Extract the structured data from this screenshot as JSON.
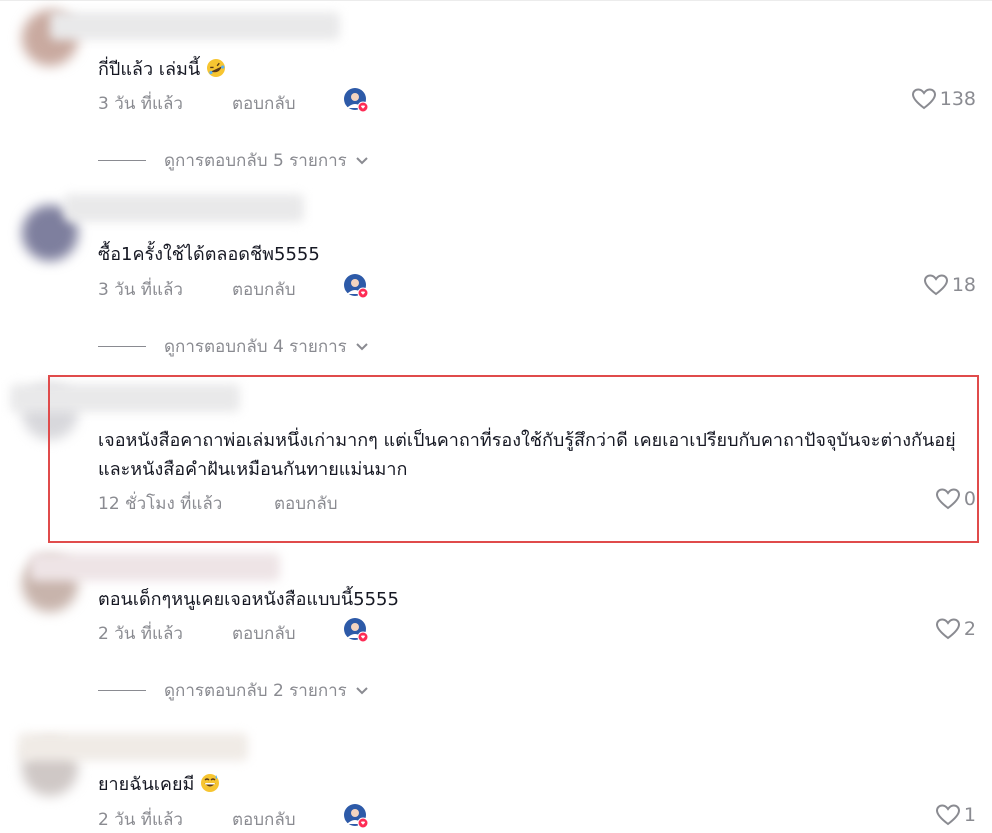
{
  "colors": {
    "highlight": "#e04b4b",
    "muted": "#8a8b91",
    "text": "#161823",
    "heart_badge": "#fe2c55"
  },
  "comments": [
    {
      "text": "กี่ปีแล้ว เล่มนี้",
      "emoji": "rolling-on-floor-laughing-emoji",
      "time": "3 วัน ที่แล้ว",
      "reply_label": "ตอบกลับ",
      "author_liked": true,
      "likes": "138",
      "view_replies": "ดูการตอบกลับ 5 รายการ"
    },
    {
      "text": "ซื้อ1ครั้งใช้ได้ตลอดชีพ5555",
      "time": "3 วัน ที่แล้ว",
      "reply_label": "ตอบกลับ",
      "author_liked": true,
      "likes": "18",
      "view_replies": "ดูการตอบกลับ 4 รายการ"
    },
    {
      "text": "เจอหนังสือคาถาพ่อเล่มหนึ่งเก่ามากๆ แต่เป็นคาถาที่รองใช้กับรู้สึกว่าดี เคยเอาเปรียบกับคาถาปัจจุบันจะต่างกันอยุ่ และหนังสือคำฝันเหมือนกันทายแม่นมาก",
      "time": "12 ชั่วโมง ที่แล้ว",
      "reply_label": "ตอบกลับ",
      "author_liked": false,
      "likes": "0",
      "highlighted": true
    },
    {
      "text": "ตอนเด็กๆหนูเคยเจอหนังสือแบบนี้5555",
      "time": "2 วัน ที่แล้ว",
      "reply_label": "ตอบกลับ",
      "author_liked": true,
      "likes": "2",
      "view_replies": "ดูการตอบกลับ 2 รายการ"
    },
    {
      "text": "ยายฉันเคยมี",
      "emoji": "grinning-sweat-emoji",
      "time": "2 วัน ที่แล้ว",
      "reply_label": "ตอบกลับ",
      "author_liked": true,
      "likes": "1"
    }
  ]
}
